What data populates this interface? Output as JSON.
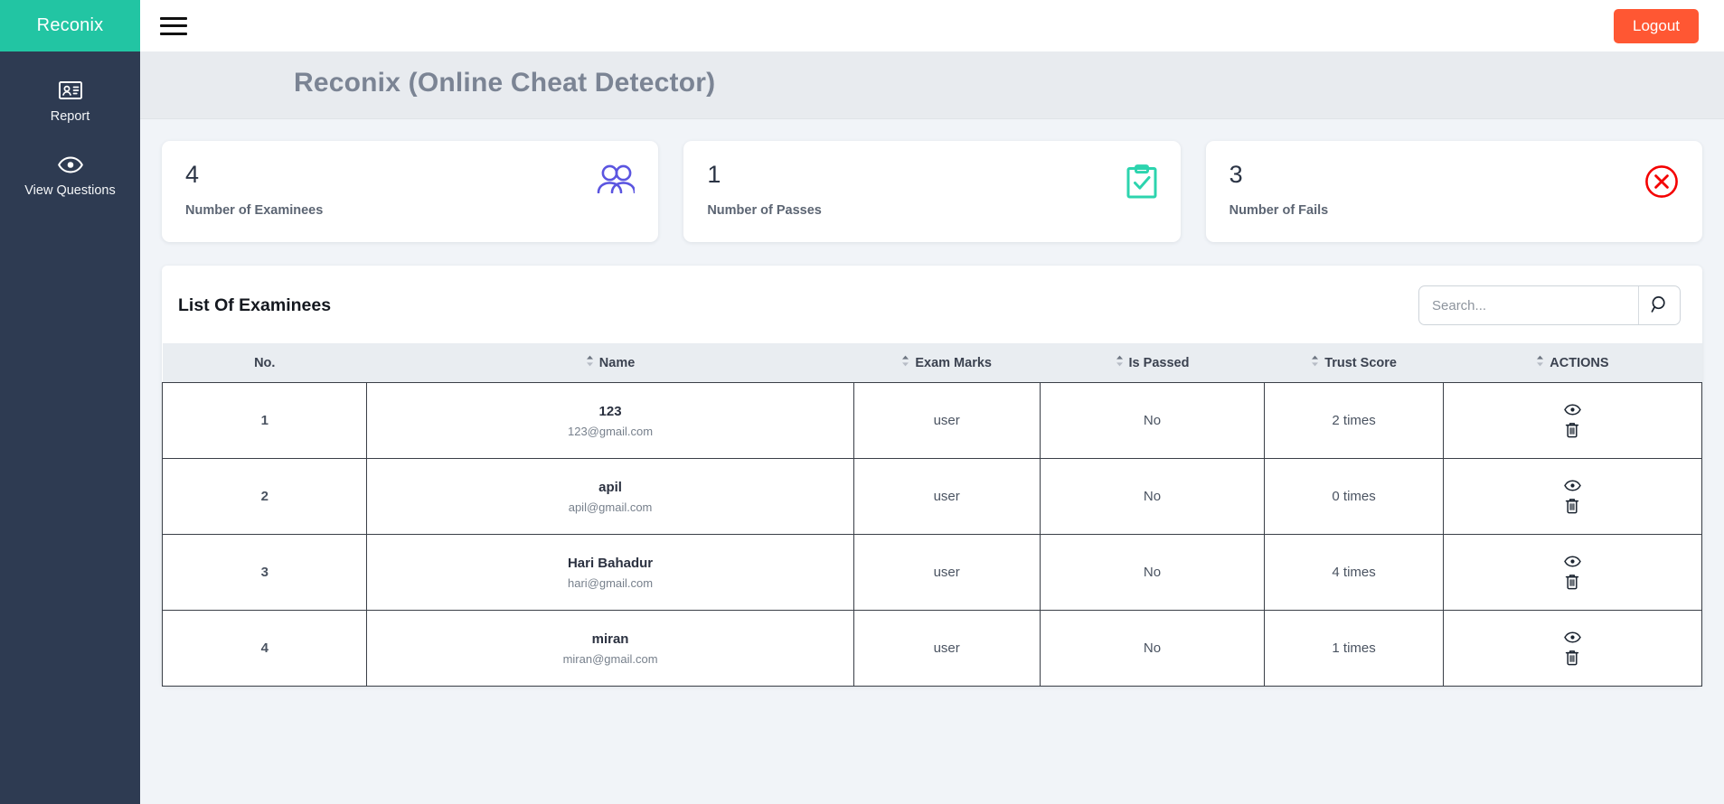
{
  "sidebar": {
    "brand": "Reconix",
    "items": [
      {
        "label": "Report",
        "icon": "id-card-icon"
      },
      {
        "label": "View Questions",
        "icon": "eye-icon"
      }
    ]
  },
  "topbar": {
    "menu_icon": "hamburger-menu-icon",
    "logout_label": "Logout",
    "logout_color": "#ff5733"
  },
  "page": {
    "title": "Reconix (Online Cheat Detector)"
  },
  "stats": [
    {
      "value": "4",
      "label": "Number of Examinees",
      "icon": "people-icon",
      "color": "#5b55e0"
    },
    {
      "value": "1",
      "label": "Number of Passes",
      "icon": "clipboard-check-icon",
      "color": "#2cd4ae"
    },
    {
      "value": "3",
      "label": "Number of Fails",
      "icon": "circle-x-icon",
      "color": "#f40000"
    }
  ],
  "table": {
    "title": "List Of Examinees",
    "search": {
      "placeholder": "Search...",
      "value": "",
      "icon": "search-icon"
    },
    "columns": [
      {
        "label": "No.",
        "sortable": false
      },
      {
        "label": "Name",
        "sortable": true
      },
      {
        "label": "Exam Marks",
        "sortable": true
      },
      {
        "label": "Is Passed",
        "sortable": true
      },
      {
        "label": "Trust Score",
        "sortable": true
      },
      {
        "label": "ACTIONS",
        "sortable": true
      }
    ],
    "rows": [
      {
        "no": "1",
        "name": "123",
        "email": "123@gmail.com",
        "exam_marks": "user",
        "is_passed": "No",
        "trust_score": "2 times"
      },
      {
        "no": "2",
        "name": "apil",
        "email": "apil@gmail.com",
        "exam_marks": "user",
        "is_passed": "No",
        "trust_score": "0 times"
      },
      {
        "no": "3",
        "name": "Hari Bahadur",
        "email": "hari@gmail.com",
        "exam_marks": "user",
        "is_passed": "No",
        "trust_score": "4 times"
      },
      {
        "no": "4",
        "name": "miran",
        "email": "miran@gmail.com",
        "exam_marks": "user",
        "is_passed": "No",
        "trust_score": "1 times"
      }
    ],
    "row_actions": [
      {
        "name": "view",
        "icon": "eye-icon"
      },
      {
        "name": "delete",
        "icon": "trash-icon"
      }
    ]
  }
}
